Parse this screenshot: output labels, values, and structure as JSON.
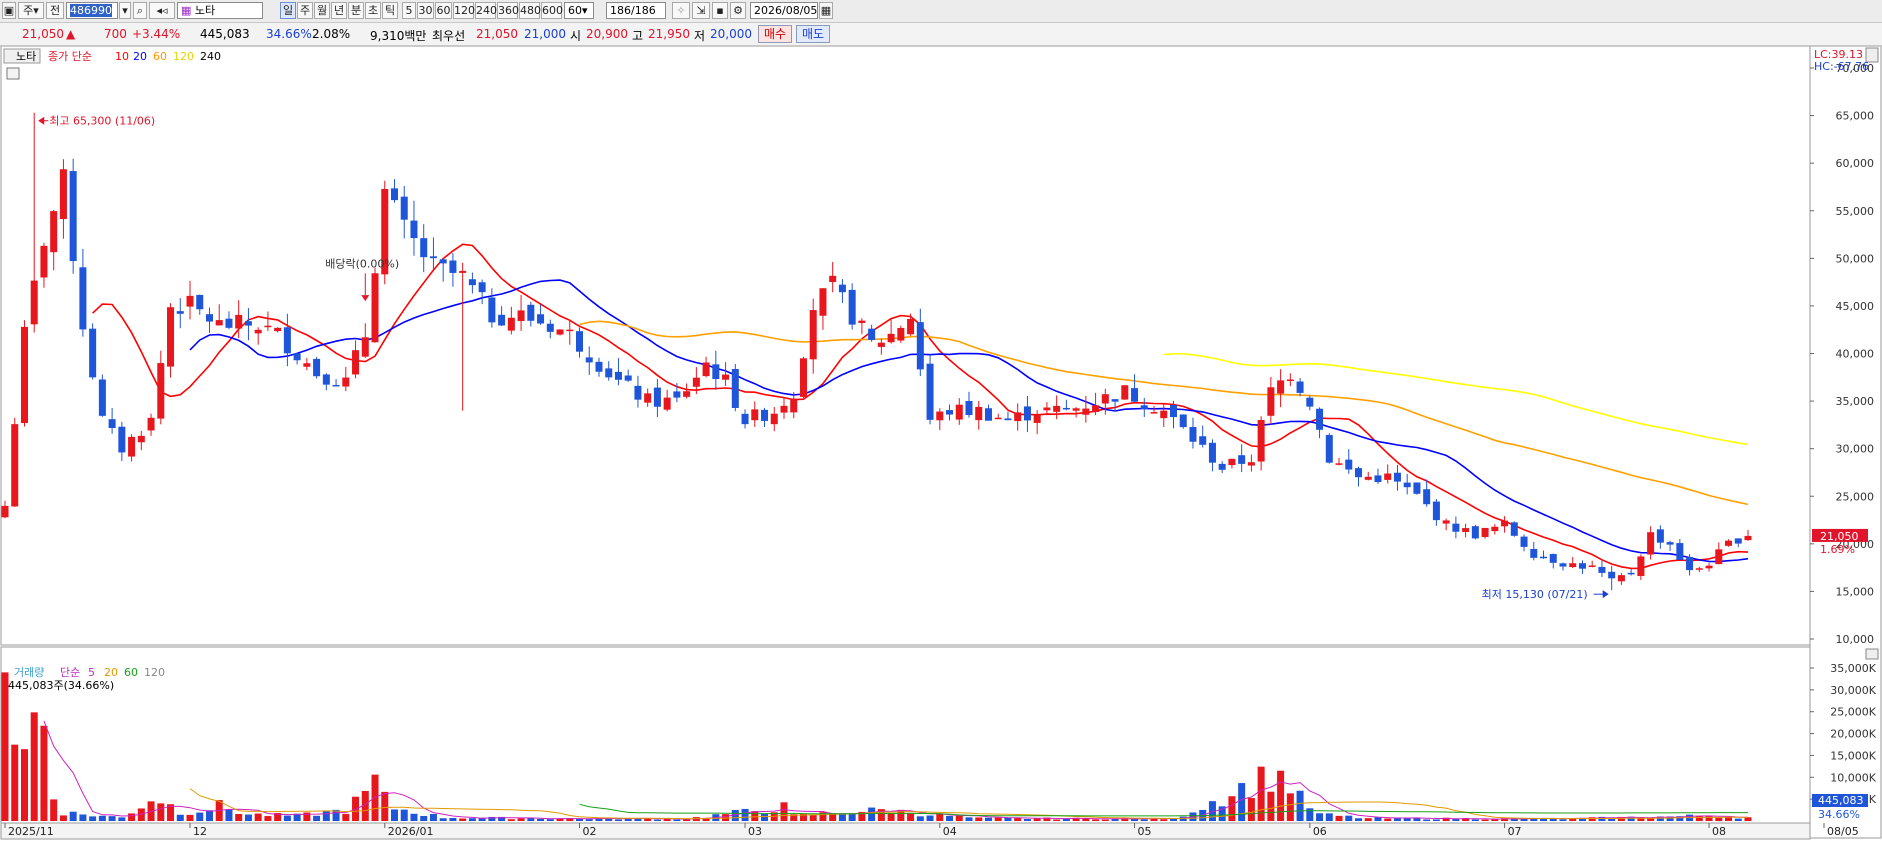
{
  "toolbar": {
    "type_label": "주",
    "market_label": "전",
    "code": "486990",
    "name": "노타",
    "periods": [
      "일",
      "주",
      "월",
      "년",
      "분",
      "초",
      "틱"
    ],
    "active_period": "일",
    "intervals": [
      "5",
      "30",
      "60",
      "120",
      "240",
      "360",
      "480",
      "600"
    ],
    "interval_value": "60",
    "count": "186",
    "count_total": "/186",
    "date": "2026/08/05"
  },
  "quote": {
    "price": "21,050",
    "change_arrow": "▲",
    "change": "700",
    "change_pct": "+3.44%",
    "volume": "445,083",
    "turnover": "34.66%",
    "ratio": "2.08%",
    "amount": "9,310백만",
    "quote_label": "최우선",
    "ask": "21,050",
    "bid": "21,000",
    "open_label": "시",
    "open": "20,900",
    "high_label": "고",
    "high": "21,950",
    "low_label": "저",
    "low": "20,000",
    "buy_label": "매수",
    "sell_label": "매도"
  },
  "legend": {
    "main_name": "노타",
    "ma_prefix": "종가 단순",
    "ma_periods": [
      "10",
      "20",
      "60",
      "120",
      "240"
    ],
    "volume_name": "거래량",
    "vol_prefix": "단순",
    "vol_periods": [
      "5",
      "20",
      "60",
      "120"
    ],
    "volume_info": "445,083주(34.66%)"
  },
  "annotations": {
    "high_note": "최고 65,300 (11/06)",
    "low_note": "최저 15,130 (07/21)",
    "dividend_note": "배당락(0.00%)",
    "lc": "LC:39.13",
    "hc": "HC:-67.76",
    "last_price": "21,050",
    "last_pct": "1.69%",
    "last_volume": "445,083",
    "last_vol_pct": "34.66%"
  },
  "colors": {
    "up": "#e8161d",
    "down": "#1f56d9",
    "ma10": "#ff0000",
    "ma20": "#0000ff",
    "ma60": "#ffa000",
    "ma120": "#ffff00",
    "ma240": "#000000"
  },
  "chart_data": {
    "type": "candlestick",
    "price_ylim": [
      10000,
      70000
    ],
    "price_ticks": [
      "70,000",
      "65,000",
      "60,000",
      "55,000",
      "50,000",
      "45,000",
      "40,000",
      "35,000",
      "30,000",
      "25,000",
      "20,000",
      "15,000",
      "10,000"
    ],
    "volume_ticks": [
      "35,000K",
      "30,000K",
      "25,000K",
      "20,000K",
      "15,000K",
      "10,000K",
      "5,000K"
    ],
    "x_labels": [
      {
        "text": "2025/11",
        "index": 0
      },
      {
        "text": "12",
        "index": 19
      },
      {
        "text": "2026/01",
        "index": 39
      },
      {
        "text": "02",
        "index": 59
      },
      {
        "text": "03",
        "index": 76
      },
      {
        "text": "04",
        "index": 96
      },
      {
        "text": "05",
        "index": 116
      },
      {
        "text": "06",
        "index": 134
      },
      {
        "text": "07",
        "index": 154
      },
      {
        "text": "08",
        "index": 175
      },
      {
        "text": "08/05",
        "index": 185
      }
    ],
    "close_waypoints": [
      [
        0,
        24000
      ],
      [
        2,
        42000
      ],
      [
        4,
        52000
      ],
      [
        6,
        58000
      ],
      [
        8,
        43000
      ],
      [
        10,
        33000
      ],
      [
        12,
        30000
      ],
      [
        15,
        33000
      ],
      [
        17,
        45000
      ],
      [
        19,
        45000
      ],
      [
        22,
        43000
      ],
      [
        26,
        43000
      ],
      [
        28,
        42000
      ],
      [
        32,
        38000
      ],
      [
        35,
        37000
      ],
      [
        37,
        42000
      ],
      [
        39,
        57000
      ],
      [
        41,
        53000
      ],
      [
        44,
        49000
      ],
      [
        47,
        48000
      ],
      [
        50,
        44000
      ],
      [
        53,
        44000
      ],
      [
        56,
        43000
      ],
      [
        58,
        42000
      ],
      [
        60,
        40000
      ],
      [
        63,
        37000
      ],
      [
        66,
        35000
      ],
      [
        69,
        35000
      ],
      [
        72,
        39000
      ],
      [
        74,
        37000
      ],
      [
        76,
        33000
      ],
      [
        79,
        34000
      ],
      [
        81,
        36000
      ],
      [
        83,
        45000
      ],
      [
        85,
        47000
      ],
      [
        87,
        44000
      ],
      [
        89,
        41000
      ],
      [
        91,
        42000
      ],
      [
        93,
        44000
      ],
      [
        95,
        33000
      ],
      [
        97,
        34000
      ],
      [
        100,
        34000
      ],
      [
        103,
        33000
      ],
      [
        106,
        34000
      ],
      [
        109,
        34000
      ],
      [
        112,
        35000
      ],
      [
        115,
        36000
      ],
      [
        117,
        35000
      ],
      [
        119,
        34000
      ],
      [
        122,
        31000
      ],
      [
        125,
        28000
      ],
      [
        128,
        29000
      ],
      [
        130,
        36000
      ],
      [
        132,
        38000
      ],
      [
        134,
        35000
      ],
      [
        136,
        29000
      ],
      [
        139,
        27000
      ],
      [
        142,
        27000
      ],
      [
        145,
        25000
      ],
      [
        148,
        22000
      ],
      [
        151,
        21000
      ],
      [
        154,
        22000
      ],
      [
        157,
        19000
      ],
      [
        160,
        18000
      ],
      [
        163,
        17500
      ],
      [
        165,
        16000
      ],
      [
        167,
        17000
      ],
      [
        169,
        21000
      ],
      [
        171,
        20000
      ],
      [
        173,
        17000
      ],
      [
        175,
        18000
      ],
      [
        177,
        20000
      ],
      [
        179,
        21050
      ]
    ],
    "high_point": {
      "index": 3,
      "value": 65300,
      "date": "11/06"
    },
    "low_point": {
      "index": 165,
      "value": 15130,
      "date": "07/21"
    },
    "dividend_index": 37,
    "volume_waypoints": [
      [
        0,
        34000
      ],
      [
        1,
        21000
      ],
      [
        2,
        15000
      ],
      [
        3,
        24000
      ],
      [
        4,
        22000
      ],
      [
        5,
        6000
      ],
      [
        6,
        2000
      ],
      [
        8,
        1500
      ],
      [
        12,
        800
      ],
      [
        15,
        5000
      ],
      [
        16,
        5000
      ],
      [
        18,
        2000
      ],
      [
        20,
        2500
      ],
      [
        22,
        3500
      ],
      [
        25,
        1500
      ],
      [
        30,
        1200
      ],
      [
        35,
        2500
      ],
      [
        37,
        6000
      ],
      [
        38,
        9000
      ],
      [
        39,
        5000
      ],
      [
        40,
        3000
      ],
      [
        45,
        800
      ],
      [
        55,
        600
      ],
      [
        70,
        500
      ],
      [
        80,
        3200
      ],
      [
        81,
        1200
      ],
      [
        90,
        2500
      ],
      [
        100,
        600
      ],
      [
        120,
        500
      ],
      [
        131,
        11500
      ],
      [
        133,
        5000
      ],
      [
        135,
        1500
      ],
      [
        140,
        600
      ],
      [
        160,
        500
      ],
      [
        175,
        1200
      ],
      [
        179,
        800
      ]
    ]
  }
}
